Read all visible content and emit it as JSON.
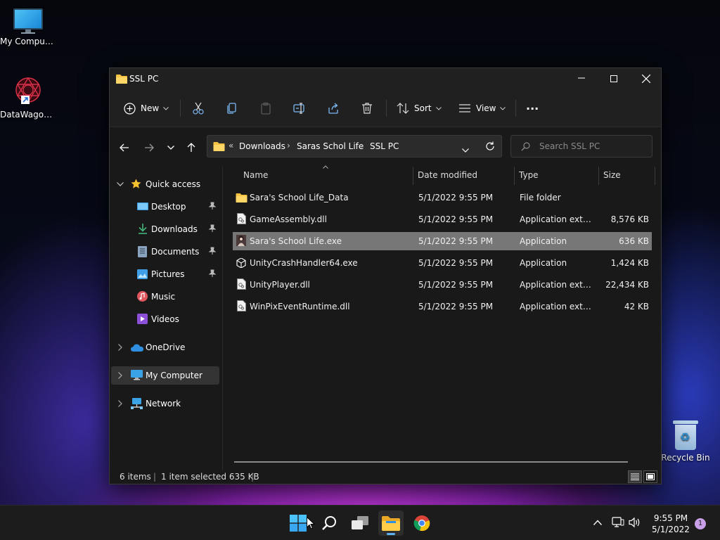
{
  "desktop": {
    "icons": [
      {
        "label": "My Computer"
      },
      {
        "label": "DataWagon..."
      },
      {
        "label": "Recycle Bin"
      }
    ]
  },
  "window": {
    "title": "SSL PC",
    "toolbar": {
      "new_label": "New",
      "sort_label": "Sort",
      "view_label": "View",
      "more_label": "···"
    },
    "address": {
      "overflow": "«",
      "crumbs": [
        "Downloads",
        "Saras Schol Life",
        "SSL PC"
      ],
      "sep": "›"
    },
    "search": {
      "placeholder": "Search SSL PC"
    },
    "nav": {
      "quick_access": "Quick access",
      "items": [
        "Desktop",
        "Downloads",
        "Documents",
        "Pictures",
        "Music",
        "Videos"
      ],
      "onedrive": "OneDrive",
      "my_computer": "My Computer",
      "network": "Network"
    },
    "columns": {
      "name": "Name",
      "date": "Date modified",
      "type": "Type",
      "size": "Size"
    },
    "files": [
      {
        "name": "Sara's School Life_Data",
        "date": "5/1/2022 9:55 PM",
        "type": "File folder",
        "size": "",
        "icon": "folder-icon"
      },
      {
        "name": "GameAssembly.dll",
        "date": "5/1/2022 9:55 PM",
        "type": "Application exten...",
        "size": "8,576 KB",
        "icon": "dll-file-icon"
      },
      {
        "name": "Sara's School Life.exe",
        "date": "5/1/2022 9:55 PM",
        "type": "Application",
        "size": "636 KB",
        "icon": "game-exe-icon"
      },
      {
        "name": "UnityCrashHandler64.exe",
        "date": "5/1/2022 9:55 PM",
        "type": "Application",
        "size": "1,424 KB",
        "icon": "unity-exe-icon"
      },
      {
        "name": "UnityPlayer.dll",
        "date": "5/1/2022 9:55 PM",
        "type": "Application exten...",
        "size": "22,434 KB",
        "icon": "dll-file-icon"
      },
      {
        "name": "WinPixEventRuntime.dll",
        "date": "5/1/2022 9:55 PM",
        "type": "Application exten...",
        "size": "42 KB",
        "icon": "dll-file-icon"
      }
    ],
    "status": {
      "count": "6 items",
      "selected": "1 item selected  635 KB",
      "sep": "|"
    }
  },
  "taskbar": {
    "time": "9:55 PM",
    "date": "5/1/2022",
    "notifications": "1"
  },
  "colors": {
    "accent": "#5fb2f2",
    "folder": "#f6c343",
    "selection": "#777777"
  }
}
